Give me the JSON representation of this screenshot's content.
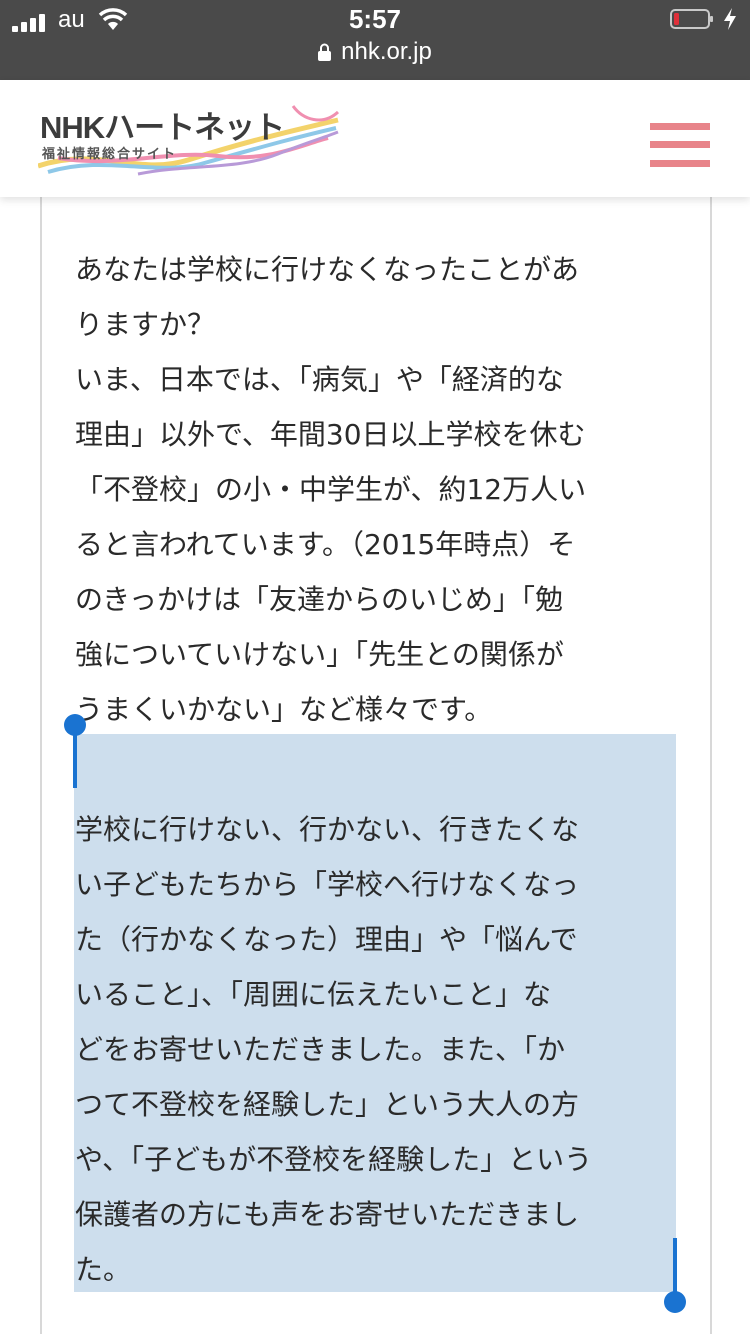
{
  "status_bar": {
    "carrier": "au",
    "time": "5:57",
    "url": "nhk.or.jp",
    "battery_color": "#e0303a"
  },
  "header": {
    "logo_main": "NHKハートネット",
    "logo_sub": "福祉情報総合サイト",
    "menu_color": "#e8848a"
  },
  "article": {
    "paragraph1_lines": [
      "あなたは学校に行けなくなったことがあ",
      "りますか？",
      "いま、日本では、「病気」や「経済的な",
      "理由」以外で、年間30日以上学校を休む",
      "「不登校」の小・中学生が、約12万人い",
      "ると言われています。（2015年時点）そ",
      "のきっかけは「友達からのいじめ」「勉",
      "強についていけない」「先生との関係が",
      "うまくいかない」など様々です。"
    ],
    "paragraph2_lines": [
      "学校に行けない、行かない、行きたくな",
      "い子どもたちから「学校へ行けなくなっ",
      "た（行かなくなった）理由」や「悩んで",
      "いること」、「周囲に伝えたいこと」な",
      "どをお寄せいただきました。また、「か",
      "つて不登校を経験した」という大人の方",
      "や、「子どもが不登校を経験した」という",
      "保護者の方にも声をお寄せいただきまし",
      "た。"
    ]
  },
  "selection": {
    "highlight_color": "#cddeed",
    "handle_color": "#1a73d1"
  }
}
